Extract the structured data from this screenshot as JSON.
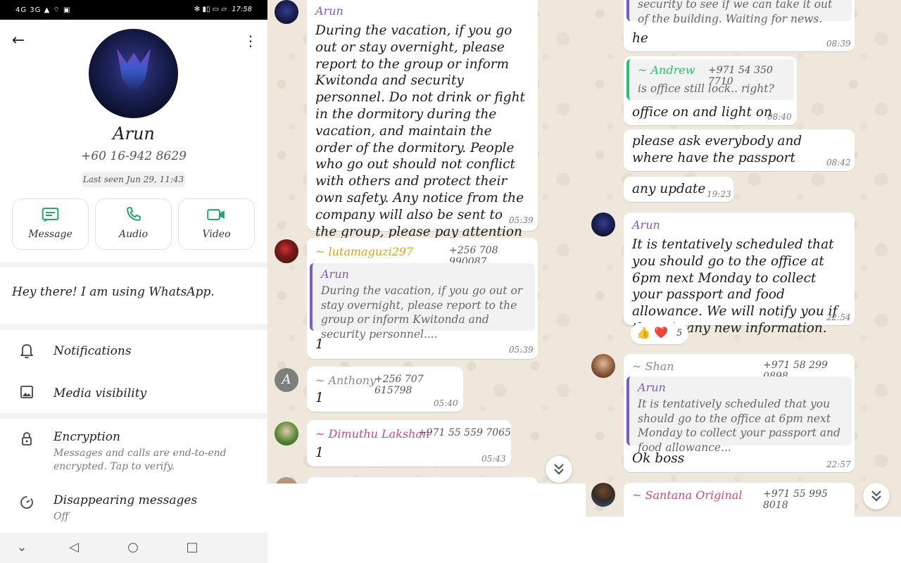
{
  "status_bar": {
    "left_icons": "4G 3G ▲ ⌔ ▣",
    "right_icons": "✻ ▮▯ ▭ ▱",
    "time": "17:58"
  },
  "contact": {
    "name": "Arun",
    "phone": "+60 16-942 8629",
    "last_seen": "Last seen Jun 29, 11:43",
    "about": "Hey there! I am using WhatsApp."
  },
  "actions": [
    {
      "label": "Message",
      "icon": "message-icon",
      "color": "#21a366"
    },
    {
      "label": "Audio",
      "icon": "phone-icon",
      "color": "#21a366"
    },
    {
      "label": "Video",
      "icon": "video-icon",
      "color": "#21a366"
    }
  ],
  "settings": {
    "notifications": "Notifications",
    "media_visibility": "Media visibility",
    "encryption_title": "Encryption",
    "encryption_sub": "Messages and calls are end-to-end encrypted. Tap to verify.",
    "disappearing_title": "Disappearing messages",
    "disappearing_sub": "Off"
  },
  "colors": {
    "accent_green": "#21a366",
    "arun_purple": "#7c5cbf",
    "chat_bg": "#efe7dc"
  },
  "mid_chat": {
    "msg1": {
      "sender": "Arun",
      "text": "During the vacation, if you go out or stay overnight, please report to the group or inform Kwitonda and security personnel. Do not drink or fight in the dormitory during the vacation, and maintain the order of the dormitory. People who go out should not conflict with others and protect their own safety. Any notice from the company will also be sent to the group, please pay attention at any time, thank you everyone.",
      "time": "05:39"
    },
    "msg2": {
      "sender": "~ lutamaguzi297",
      "phone": "+256 708 990087",
      "quote_name": "Arun",
      "quote_text": "During the vacation, if you go out or stay overnight, please report to the group or inform Kwitonda and security personnel....",
      "text": "1",
      "time": "05:39"
    },
    "msg3": {
      "avatar_letter": "A",
      "sender": "~ Anthony",
      "phone": "+256 707 615798",
      "text": "1",
      "time": "05:40"
    },
    "msg4": {
      "sender": "~ Dimuthu Lakshan",
      "phone": "+971 55 559 7065",
      "text": "1",
      "time": "05:43"
    }
  },
  "right_chat": {
    "msg0": {
      "text_partial": "security to see if we can take it out of the building. Waiting for news."
    },
    "msg1": {
      "text": "he",
      "time": "08:39"
    },
    "msg2": {
      "quote_name": "~ Andrew",
      "quote_phone": "+971 54 350 7710",
      "quote_text": "is office still lock.. right?",
      "text": "office on and light on",
      "time": "08:40"
    },
    "msg3": {
      "text": "please ask everybody and where have the passport",
      "time": "08:42"
    },
    "msg4": {
      "text": "any update",
      "time": "19:23"
    },
    "msg5": {
      "sender": "Arun",
      "text": "It is tentatively scheduled that you should go to the office at 6pm next Monday to collect your passport and food allowance. We will notify you if there is any new information.",
      "time": "22:54",
      "reactions": "👍 ❤️",
      "reaction_count": "5"
    },
    "msg6": {
      "sender": "~ Shan",
      "phone": "+971 58 299 0898",
      "quote_name": "Arun",
      "quote_text": "It is tentatively scheduled that you should go to the office at 6pm next Monday to collect your passport and food allowance...",
      "text": "Ok boss",
      "time": "22:57"
    },
    "msg7": {
      "sender": "~ Santana Original",
      "phone": "+971 55 995 8018"
    }
  }
}
